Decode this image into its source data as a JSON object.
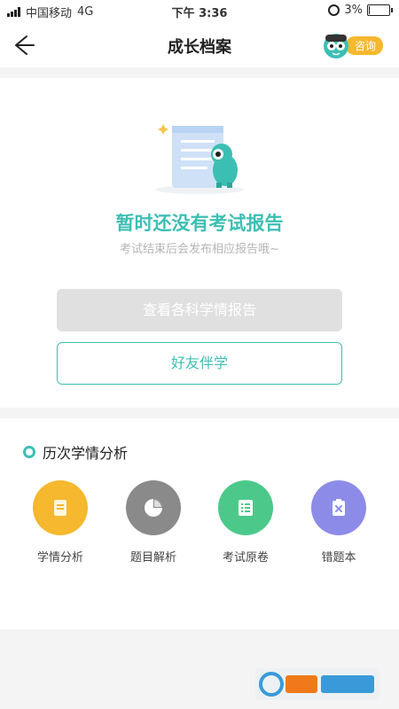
{
  "status_bar": {
    "carrier": "中国移动",
    "network": "4G",
    "time": "下午 3:36",
    "battery": "3%",
    "battery_level": 0.03
  },
  "nav": {
    "title": "成长档案",
    "consult_label": "咨询"
  },
  "empty_state": {
    "title": "暂时还没有考试报告",
    "subtitle": "考试结束后会发布相应报告哦~",
    "view_reports_label": "查看各科学情报告",
    "study_buddy_label": "好友伴学"
  },
  "history": {
    "section_title": "历次学情分析",
    "items": [
      {
        "label": "学情分析",
        "icon": "document-icon",
        "color": "#f5b82e"
      },
      {
        "label": "题目解析",
        "icon": "pie-chart-icon",
        "color": "#8a8a8a"
      },
      {
        "label": "考试原卷",
        "icon": "list-icon",
        "color": "#4cc98a"
      },
      {
        "label": "错题本",
        "icon": "wrong-notebook-icon",
        "color": "#8c8ce8"
      }
    ]
  },
  "colors": {
    "accent": "#3cbfb3",
    "consult": "#f5b82e"
  }
}
